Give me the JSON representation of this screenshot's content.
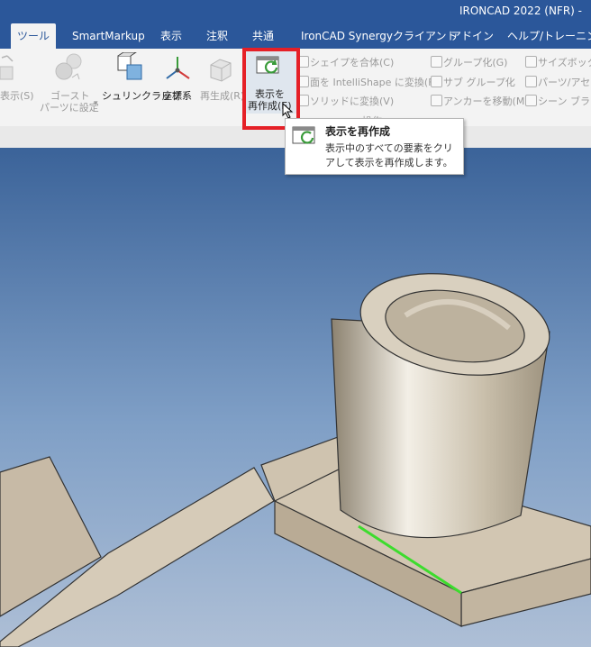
{
  "app": {
    "title": "IRONCAD 2022 (NFR) -"
  },
  "tabs": [
    {
      "label": "ツール",
      "active": true
    },
    {
      "label": "SmartMarkup"
    },
    {
      "label": "表示"
    },
    {
      "label": "注釈"
    },
    {
      "label": "共通"
    },
    {
      "label": "IronCAD Synergyクライアント"
    },
    {
      "label": "アドイン"
    },
    {
      "label": "ヘルプ/トレーニング"
    }
  ],
  "ribbon": {
    "show_label": "表示(S)",
    "ghost_line1": "ゴースト",
    "ghost_line2": "パーツに設定",
    "shrinkwrap": "シュリンクラップ",
    "coordsys": "座標系",
    "regenerate": "再生成(R)",
    "redraw_line1": "表示を",
    "redraw_line2": "再作成(E)",
    "combine_shape": "シェイプを合体(C)",
    "face_to_intellishape": "面を IntelliShape に変換(F)",
    "convert_to_solid": "ソリッドに変換(V)",
    "group_label": "操作",
    "grouping": "グループ化(G)",
    "sub_group": "サブ グループ化",
    "move_anchor": "アンカーを移動(M)",
    "size_box": "サイズボックス",
    "parts_assembly": "パーツ/アセン",
    "scene_browser": "シーン ブラウ"
  },
  "tooltip": {
    "title": "表示を再作成",
    "description": "表示中のすべての要素をクリアして表示を再作成します。"
  },
  "colors": {
    "titlebar": "#2b579a",
    "highlight": "#e52027",
    "model_tan": "#d0c4b0",
    "edge_green": "#3ddc2e"
  }
}
